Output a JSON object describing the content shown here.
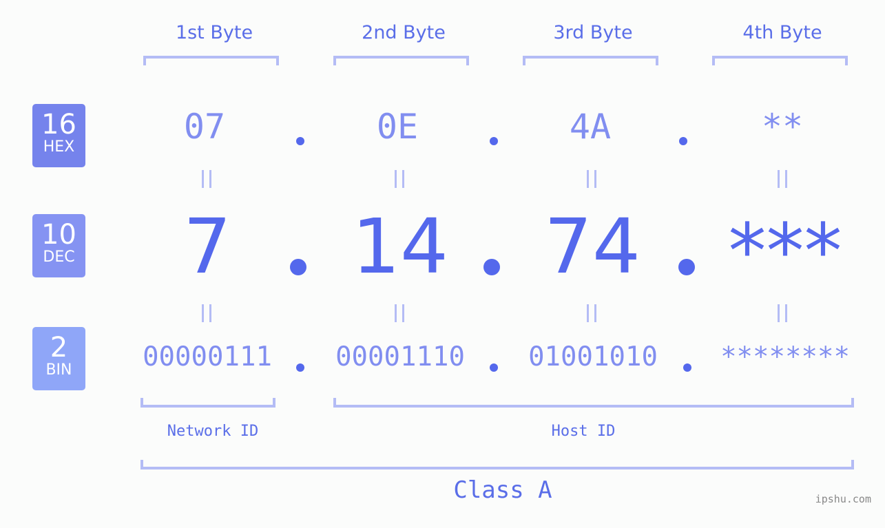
{
  "colors": {
    "hex_badge": "#7583ec",
    "dec_badge": "#8593f2",
    "bin_badge": "#8fa6f8",
    "accent": "#5468ec",
    "light_value": "#818ef0",
    "bracket": "#b4bcf5",
    "background": "#fbfcfb"
  },
  "byte_headers": [
    "1st Byte",
    "2nd Byte",
    "3rd Byte",
    "4th Byte"
  ],
  "badges": {
    "hex": {
      "number": "16",
      "label": "HEX"
    },
    "dec": {
      "number": "10",
      "label": "DEC"
    },
    "bin": {
      "number": "2",
      "label": "BIN"
    }
  },
  "hex_values": [
    "07",
    "0E",
    "4A",
    "**"
  ],
  "dec_values": [
    "7",
    "14",
    "74",
    "***"
  ],
  "bin_values": [
    "00000111",
    "00001110",
    "01001010",
    "********"
  ],
  "separator": ".",
  "segments": {
    "network_id": "Network ID",
    "host_id": "Host ID",
    "class": "Class A"
  },
  "watermark": "ipshu.com"
}
